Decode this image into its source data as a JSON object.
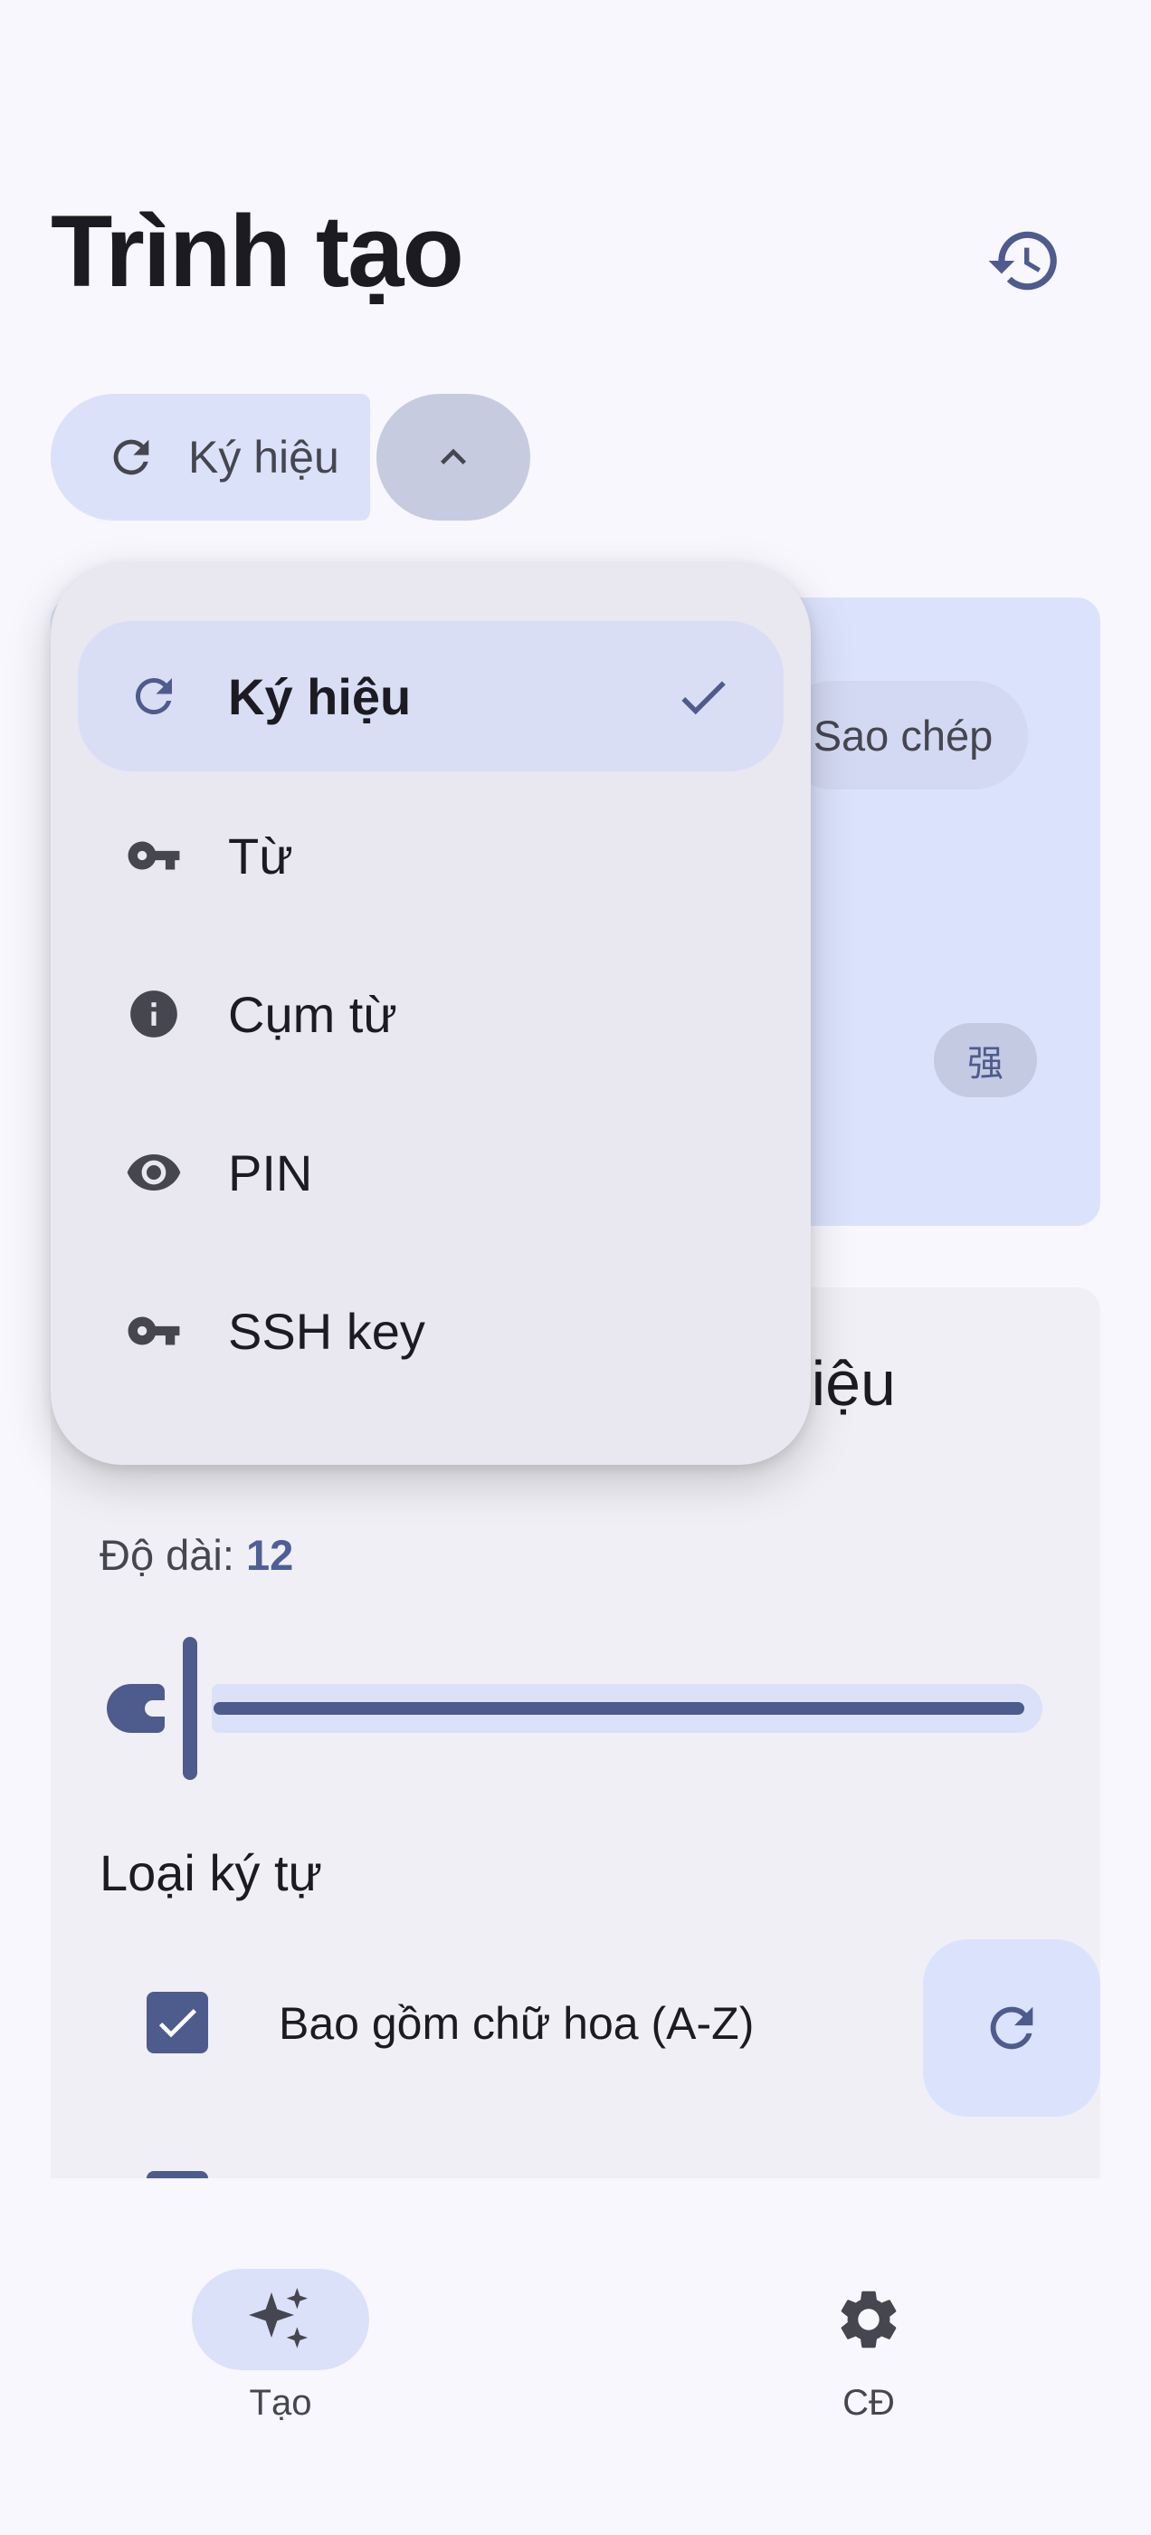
{
  "header": {
    "title": "Trình tạo"
  },
  "type_selector": {
    "selected_label": "Ký hiệu"
  },
  "password_card": {
    "copy_label": "Sao chép",
    "strength_label": "强"
  },
  "options_card": {
    "title_fragment": "iệu",
    "length_label": "Độ dài: ",
    "length_value": "12",
    "char_types_label": "Loại ký tự",
    "options": [
      {
        "label": "Bao gồm chữ hoa (A-Z)",
        "checked": true
      }
    ]
  },
  "menu": {
    "items": [
      {
        "label": "Ký hiệu",
        "icon": "refresh-icon",
        "selected": true
      },
      {
        "label": "Từ",
        "icon": "key-icon",
        "selected": false
      },
      {
        "label": "Cụm từ",
        "icon": "info-icon",
        "selected": false
      },
      {
        "label": "PIN",
        "icon": "eye-icon",
        "selected": false
      },
      {
        "label": "SSH key",
        "icon": "key-icon",
        "selected": false
      }
    ]
  },
  "bottom_nav": {
    "items": [
      {
        "label": "Tạo",
        "icon": "sparkle-icon",
        "active": true
      },
      {
        "label": "CĐ",
        "icon": "gear-icon",
        "active": false
      }
    ]
  },
  "colors": {
    "primary": "#4e5b8d",
    "container": "#dbe1f8",
    "surface": "#f7f7fd"
  }
}
